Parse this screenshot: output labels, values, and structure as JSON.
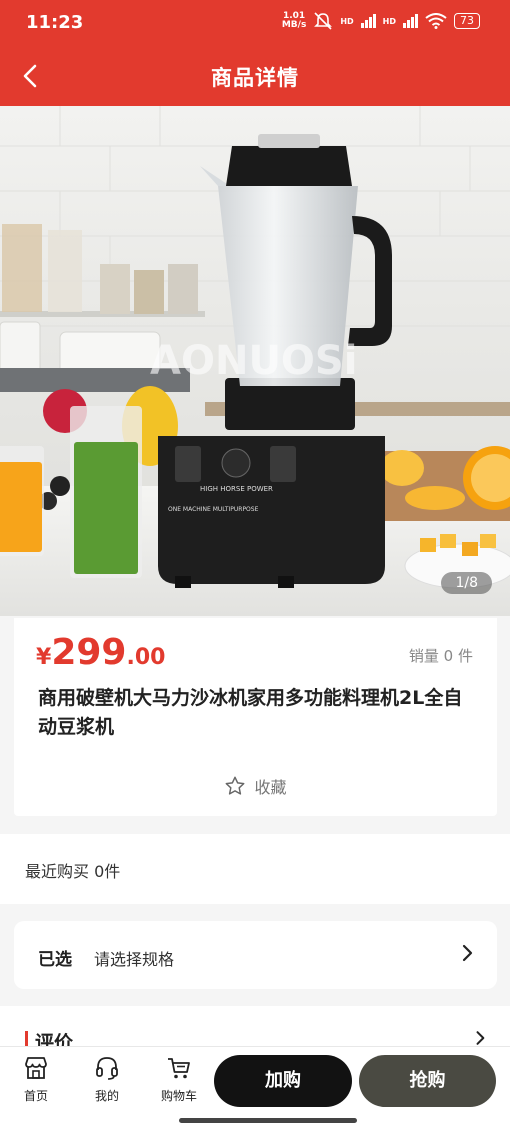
{
  "status": {
    "time": "11:23",
    "net_speed": "1.01",
    "net_unit": "MB/s",
    "battery": "73",
    "hd1": "HD",
    "hd2": "HD"
  },
  "nav": {
    "title": "商品详情"
  },
  "hero": {
    "watermark": "AONUOSi",
    "counter": "1/8",
    "label_top": "HIGH HORSE POWER",
    "label_bottom": "ONE MACHINE MULTIPURPOSE"
  },
  "product": {
    "currency": "¥",
    "price_int": "299",
    "price_dec": ".00",
    "sales": "销量 0 件",
    "title": "商用破壁机大马力沙冰机家用多功能料理机2L全自动豆浆机",
    "favorite": "收藏"
  },
  "recent": {
    "text": "最近购买  0件"
  },
  "spec": {
    "label": "已选",
    "value": "请选择规格"
  },
  "review": {
    "label": "评价"
  },
  "bottom": {
    "home": "首页",
    "mine": "我的",
    "cart": "购物车",
    "add_cart": "加购",
    "buy": "抢购"
  },
  "colors": {
    "brand_red": "#e23a2e",
    "add_cart_bg": "#121212",
    "buy_bg": "#4a4a42"
  }
}
